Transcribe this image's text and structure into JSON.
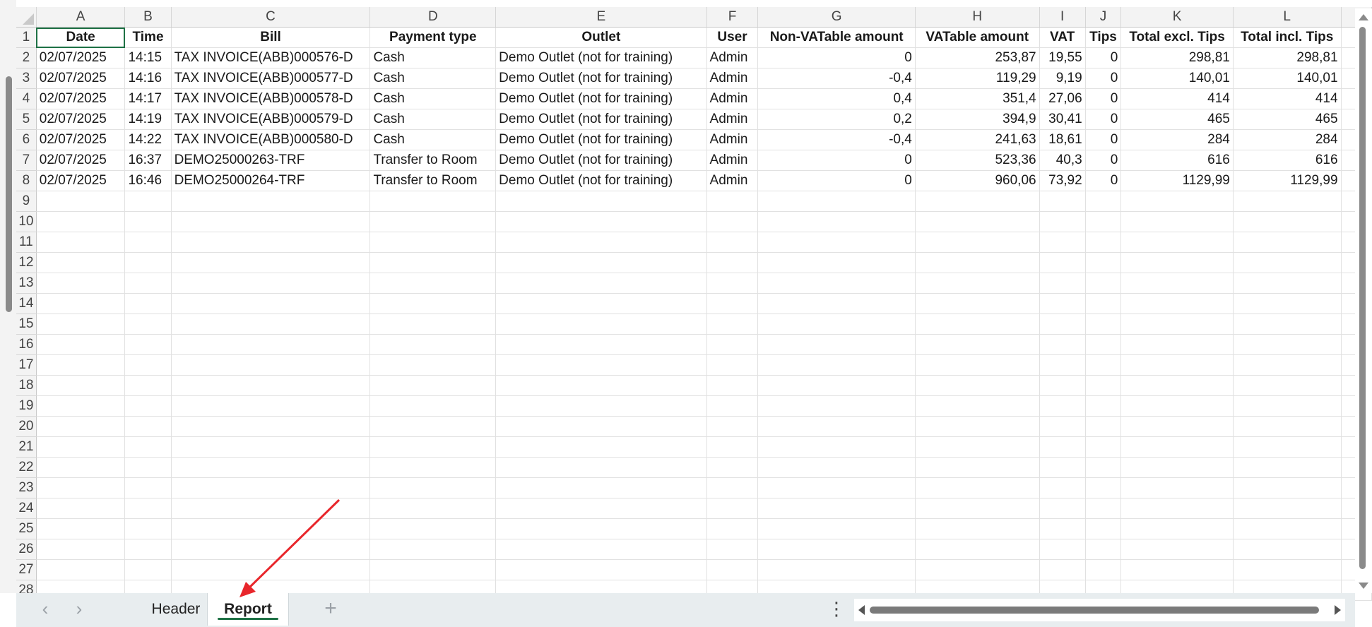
{
  "columns": [
    "A",
    "B",
    "C",
    "D",
    "E",
    "F",
    "G",
    "H",
    "I",
    "J",
    "K",
    "L"
  ],
  "header_row": [
    "Date",
    "Time",
    "Bill",
    "Payment type",
    "Outlet",
    "User",
    "Non-VATable amount",
    "VATable amount",
    "VAT",
    "Tips",
    "Total excl. Tips",
    "Total incl. Tips"
  ],
  "rows": [
    [
      "02/07/2025",
      "14:15",
      "TAX INVOICE(ABB)000576-D",
      "Cash",
      "Demo Outlet (not for training)",
      "Admin",
      "0",
      "253,87",
      "19,55",
      "0",
      "298,81",
      "298,81"
    ],
    [
      "02/07/2025",
      "14:16",
      "TAX INVOICE(ABB)000577-D",
      "Cash",
      "Demo Outlet (not for training)",
      "Admin",
      "-0,4",
      "119,29",
      "9,19",
      "0",
      "140,01",
      "140,01"
    ],
    [
      "02/07/2025",
      "14:17",
      "TAX INVOICE(ABB)000578-D",
      "Cash",
      "Demo Outlet (not for training)",
      "Admin",
      "0,4",
      "351,4",
      "27,06",
      "0",
      "414",
      "414"
    ],
    [
      "02/07/2025",
      "14:19",
      "TAX INVOICE(ABB)000579-D",
      "Cash",
      "Demo Outlet (not for training)",
      "Admin",
      "0,2",
      "394,9",
      "30,41",
      "0",
      "465",
      "465"
    ],
    [
      "02/07/2025",
      "14:22",
      "TAX INVOICE(ABB)000580-D",
      "Cash",
      "Demo Outlet (not for training)",
      "Admin",
      "-0,4",
      "241,63",
      "18,61",
      "0",
      "284",
      "284"
    ],
    [
      "02/07/2025",
      "16:37",
      "DEMO25000263-TRF",
      "Transfer to Room",
      "Demo Outlet (not for training)",
      "Admin",
      "0",
      "523,36",
      "40,3",
      "0",
      "616",
      "616"
    ],
    [
      "02/07/2025",
      "16:46",
      "DEMO25000264-TRF",
      "Transfer to Room",
      "Demo Outlet (not for training)",
      "Admin",
      "0",
      "960,06",
      "73,92",
      "0",
      "1129,99",
      "1129,99"
    ]
  ],
  "row_numbers": [
    "1",
    "2",
    "3",
    "4",
    "5",
    "6",
    "7",
    "8",
    "9",
    "10",
    "11",
    "12",
    "13",
    "14",
    "15",
    "16",
    "17",
    "18",
    "19",
    "20",
    "21",
    "22",
    "23",
    "24",
    "25",
    "26",
    "27",
    "28"
  ],
  "sheet_tabs": {
    "header": "Header",
    "report": "Report",
    "active": "Report"
  },
  "icons": {
    "prev_sheet": "chevron-left-icon",
    "next_sheet": "chevron-right-icon",
    "add_sheet": "plus-icon",
    "more_options": "vertical-ellipsis-icon"
  },
  "colors": {
    "accent": "#1e7145",
    "annotation_arrow": "#e8262b"
  }
}
